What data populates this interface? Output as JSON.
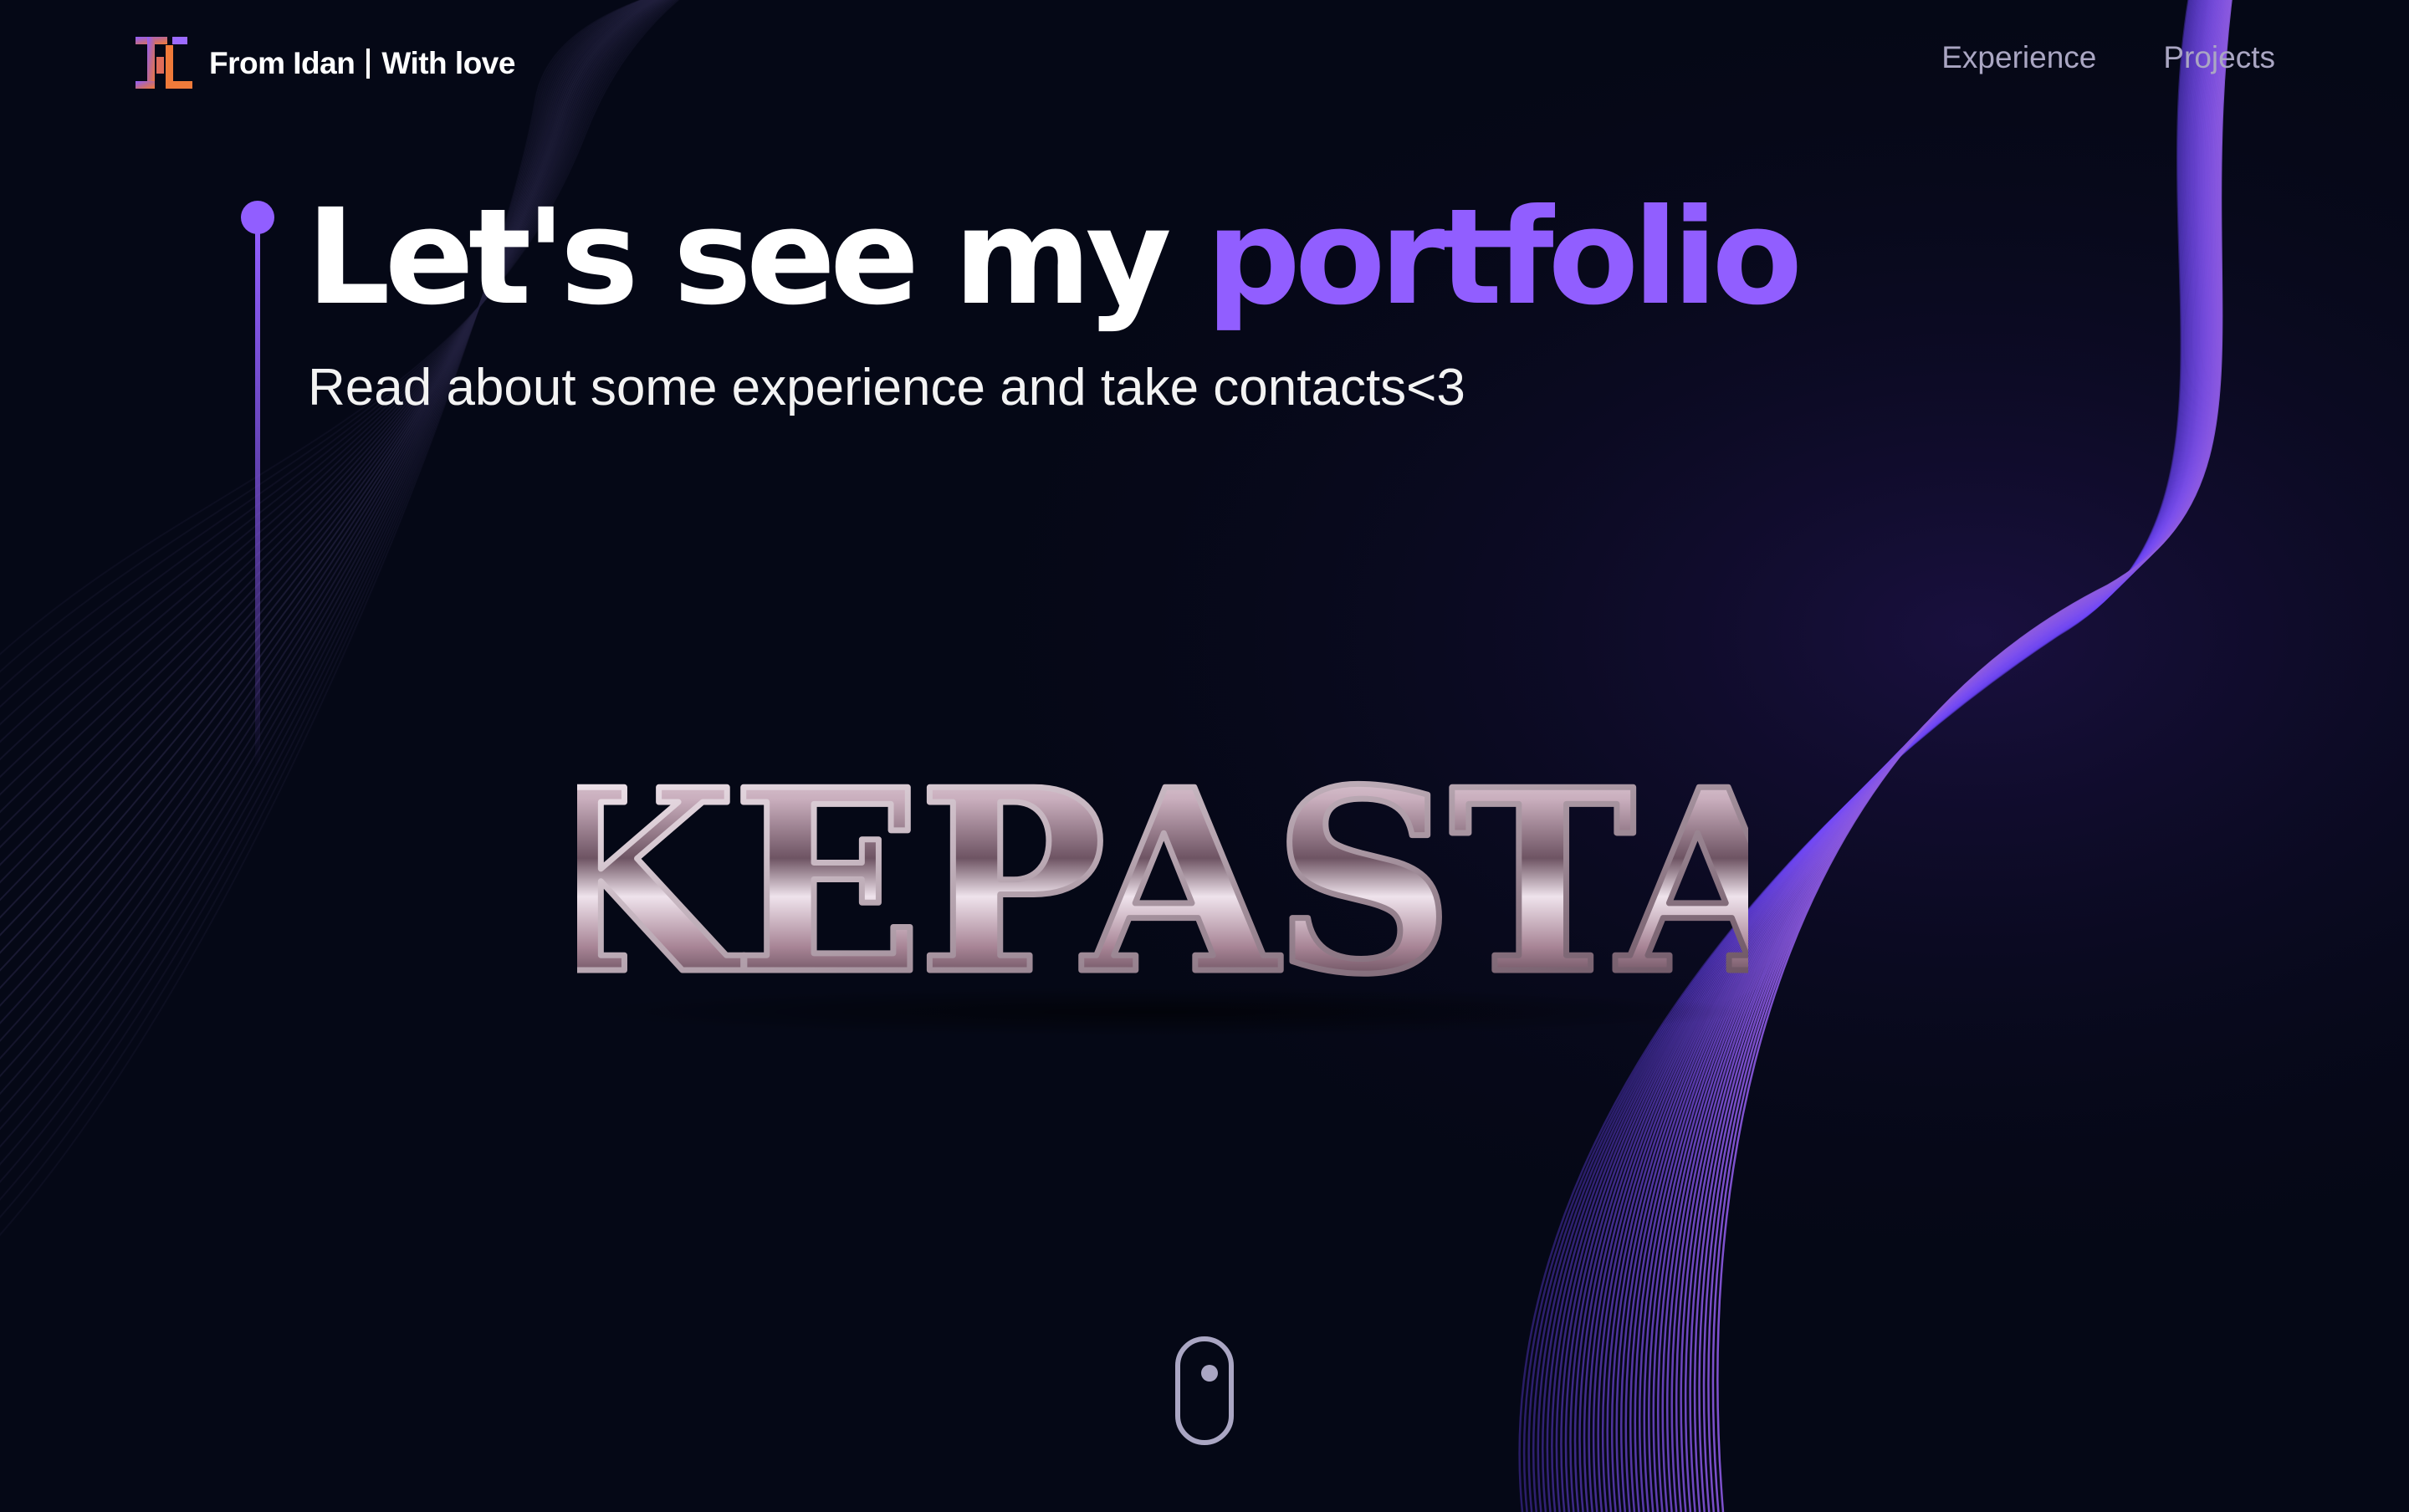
{
  "navbar": {
    "logo_icon": "logo-monogram-icon",
    "brand_name": "From Idan",
    "brand_tagline": "With love",
    "links": [
      {
        "label": "Experience"
      },
      {
        "label": "Projects"
      }
    ]
  },
  "hero": {
    "title_prefix": "Let's see my ",
    "title_accent": "portfolio",
    "subtitle": "Read about some experience and take contacts<3",
    "chrome_word": "KEPASTA",
    "scroll_icon": "mouse-scroll-icon"
  },
  "colors": {
    "background": "#050816",
    "accent": "#915eff",
    "secondary_text": "#aaa6c3",
    "white": "#ffffff"
  }
}
